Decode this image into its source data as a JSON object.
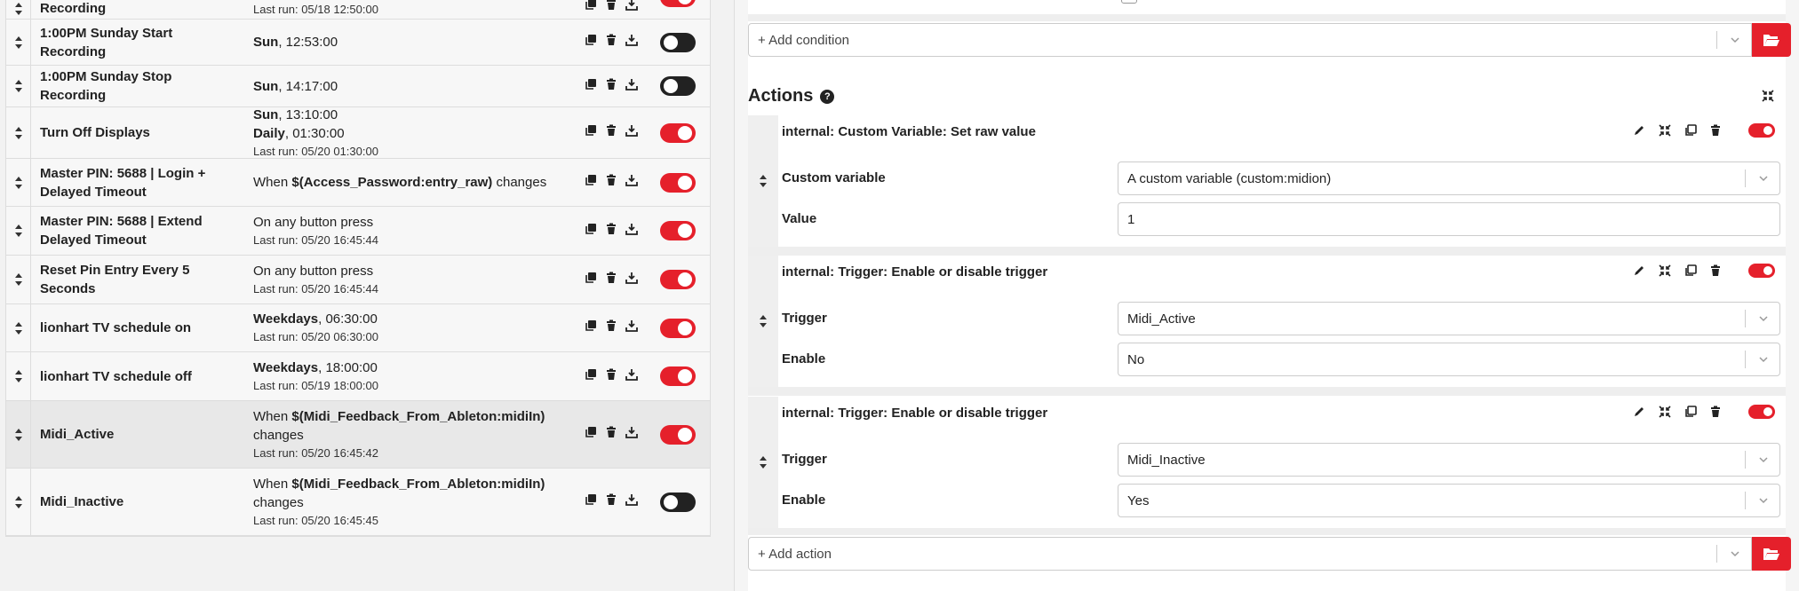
{
  "triggers": [
    {
      "name": "Recording",
      "lines": [],
      "last": "Last run: 05/18 12:50:00",
      "enabled": true
    },
    {
      "name": "1:00PM Sunday Start Recording",
      "lines": [
        {
          "b": "Sun",
          "t": ", 12:53:00"
        }
      ],
      "last": "",
      "enabled": false
    },
    {
      "name": "1:00PM Sunday Stop Recording",
      "lines": [
        {
          "b": "Sun",
          "t": ", 14:17:00"
        }
      ],
      "last": "",
      "enabled": false
    },
    {
      "name": "Turn Off Displays",
      "lines": [
        {
          "b": "Sun",
          "t": ", 13:10:00"
        },
        {
          "b": "Daily",
          "t": ", 01:30:00"
        }
      ],
      "last": "Last run: 05/20 01:30:00",
      "enabled": true
    },
    {
      "name": "Master PIN: 5688 | Login + Delayed Timeout",
      "lines": [
        {
          "p": "When ",
          "b": "$(Access_Password:entry_raw)",
          "t": " changes"
        }
      ],
      "last": "",
      "enabled": true
    },
    {
      "name": "Master PIN: 5688 | Extend Delayed Timeout",
      "lines": [
        {
          "t": "On any button press"
        }
      ],
      "last": "Last run: 05/20 16:45:44",
      "enabled": true
    },
    {
      "name": "Reset Pin Entry Every 5 Seconds",
      "lines": [
        {
          "t": "On any button press"
        }
      ],
      "last": "Last run: 05/20 16:45:44",
      "enabled": true
    },
    {
      "name": "lionhart TV schedule on",
      "lines": [
        {
          "b": "Weekdays",
          "t": ", 06:30:00"
        }
      ],
      "last": "Last run: 05/20 06:30:00",
      "enabled": true
    },
    {
      "name": "lionhart TV schedule off",
      "lines": [
        {
          "b": "Weekdays",
          "t": ", 18:00:00"
        }
      ],
      "last": "Last run: 05/19 18:00:00",
      "enabled": true
    },
    {
      "name": "Midi_Active",
      "lines": [
        {
          "p": "When ",
          "b": "$(Midi_Feedback_From_Ableton:midiIn)",
          "t": ""
        },
        {
          "t": "changes"
        }
      ],
      "last": "Last run: 05/20 16:45:42",
      "enabled": true,
      "selected": true
    },
    {
      "name": "Midi_Inactive",
      "lines": [
        {
          "p": "When ",
          "b": "$(Midi_Feedback_From_Ableton:midiIn)",
          "t": ""
        },
        {
          "t": "changes"
        }
      ],
      "last": "Last run: 05/20 16:45:45",
      "enabled": false
    }
  ],
  "editor": {
    "add_condition": "+ Add condition",
    "actions_heading": "Actions",
    "help_glyph": "?",
    "add_action": "+ Add action",
    "actions": [
      {
        "title": "internal: Custom Variable: Set raw value",
        "fields": [
          {
            "label": "Custom variable",
            "value": "A custom variable (custom:midion)",
            "type": "select"
          },
          {
            "label": "Value",
            "value": "1",
            "type": "text"
          }
        ]
      },
      {
        "title": "internal: Trigger: Enable or disable trigger",
        "fields": [
          {
            "label": "Trigger",
            "value": "Midi_Active",
            "type": "select"
          },
          {
            "label": "Enable",
            "value": "No",
            "type": "select"
          }
        ]
      },
      {
        "title": "internal: Trigger: Enable or disable trigger",
        "fields": [
          {
            "label": "Trigger",
            "value": "Midi_Inactive",
            "type": "select"
          },
          {
            "label": "Enable",
            "value": "Yes",
            "type": "select"
          }
        ]
      }
    ]
  },
  "colors": {
    "accent": "#e5202b",
    "toggle_off": "#222222"
  }
}
